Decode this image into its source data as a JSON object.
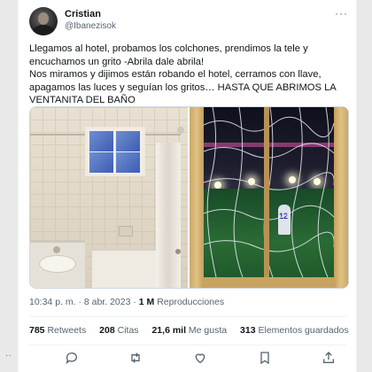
{
  "tweet": {
    "author": {
      "name": "Cristian",
      "handle": "@Ibanezisok"
    },
    "text": "Llegamos al hotel, probamos los colchones, prendimos la tele y encuchamos un grito -Abrila dale abrila!\nNos miramos y dijimos están robando el hotel, cerramos con llave, apagamos las luces y seguían los gritos… HASTA QUE ABRIMOS LA VENTANITA DEL BAÑO",
    "media": {
      "photo1_icon": "bathroom-photo",
      "photo2_icon": "stadium-photo",
      "player_number": "12"
    },
    "time": "10:34 p. m.",
    "date": "8 abr. 2023",
    "dot": "·",
    "views_count": "1 M",
    "views_label": "Reproducciones"
  },
  "stats": {
    "retweets_count": "785",
    "retweets_label": "Retweets",
    "quotes_count": "208",
    "quotes_label": "Citas",
    "likes_count": "21,6 mil",
    "likes_label": "Me gusta",
    "bookmarks_count": "313",
    "bookmarks_label": "Elementos guardados"
  },
  "ui": {
    "more": "···",
    "left_dot": "··"
  },
  "colors": {
    "text": "#0f1419",
    "muted": "#536471",
    "divider": "#eff3f4"
  }
}
